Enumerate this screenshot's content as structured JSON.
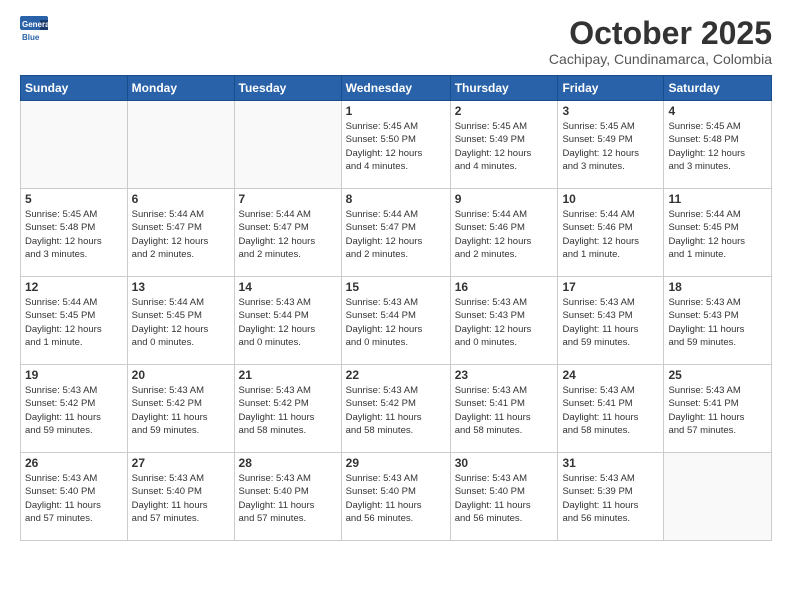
{
  "header": {
    "logo_general": "General",
    "logo_blue": "Blue",
    "month": "October 2025",
    "location": "Cachipay, Cundinamarca, Colombia"
  },
  "weekdays": [
    "Sunday",
    "Monday",
    "Tuesday",
    "Wednesday",
    "Thursday",
    "Friday",
    "Saturday"
  ],
  "weeks": [
    [
      {
        "day": "",
        "info": ""
      },
      {
        "day": "",
        "info": ""
      },
      {
        "day": "",
        "info": ""
      },
      {
        "day": "1",
        "info": "Sunrise: 5:45 AM\nSunset: 5:50 PM\nDaylight: 12 hours\nand 4 minutes."
      },
      {
        "day": "2",
        "info": "Sunrise: 5:45 AM\nSunset: 5:49 PM\nDaylight: 12 hours\nand 4 minutes."
      },
      {
        "day": "3",
        "info": "Sunrise: 5:45 AM\nSunset: 5:49 PM\nDaylight: 12 hours\nand 3 minutes."
      },
      {
        "day": "4",
        "info": "Sunrise: 5:45 AM\nSunset: 5:48 PM\nDaylight: 12 hours\nand 3 minutes."
      }
    ],
    [
      {
        "day": "5",
        "info": "Sunrise: 5:45 AM\nSunset: 5:48 PM\nDaylight: 12 hours\nand 3 minutes."
      },
      {
        "day": "6",
        "info": "Sunrise: 5:44 AM\nSunset: 5:47 PM\nDaylight: 12 hours\nand 2 minutes."
      },
      {
        "day": "7",
        "info": "Sunrise: 5:44 AM\nSunset: 5:47 PM\nDaylight: 12 hours\nand 2 minutes."
      },
      {
        "day": "8",
        "info": "Sunrise: 5:44 AM\nSunset: 5:47 PM\nDaylight: 12 hours\nand 2 minutes."
      },
      {
        "day": "9",
        "info": "Sunrise: 5:44 AM\nSunset: 5:46 PM\nDaylight: 12 hours\nand 2 minutes."
      },
      {
        "day": "10",
        "info": "Sunrise: 5:44 AM\nSunset: 5:46 PM\nDaylight: 12 hours\nand 1 minute."
      },
      {
        "day": "11",
        "info": "Sunrise: 5:44 AM\nSunset: 5:45 PM\nDaylight: 12 hours\nand 1 minute."
      }
    ],
    [
      {
        "day": "12",
        "info": "Sunrise: 5:44 AM\nSunset: 5:45 PM\nDaylight: 12 hours\nand 1 minute."
      },
      {
        "day": "13",
        "info": "Sunrise: 5:44 AM\nSunset: 5:45 PM\nDaylight: 12 hours\nand 0 minutes."
      },
      {
        "day": "14",
        "info": "Sunrise: 5:43 AM\nSunset: 5:44 PM\nDaylight: 12 hours\nand 0 minutes."
      },
      {
        "day": "15",
        "info": "Sunrise: 5:43 AM\nSunset: 5:44 PM\nDaylight: 12 hours\nand 0 minutes."
      },
      {
        "day": "16",
        "info": "Sunrise: 5:43 AM\nSunset: 5:43 PM\nDaylight: 12 hours\nand 0 minutes."
      },
      {
        "day": "17",
        "info": "Sunrise: 5:43 AM\nSunset: 5:43 PM\nDaylight: 11 hours\nand 59 minutes."
      },
      {
        "day": "18",
        "info": "Sunrise: 5:43 AM\nSunset: 5:43 PM\nDaylight: 11 hours\nand 59 minutes."
      }
    ],
    [
      {
        "day": "19",
        "info": "Sunrise: 5:43 AM\nSunset: 5:42 PM\nDaylight: 11 hours\nand 59 minutes."
      },
      {
        "day": "20",
        "info": "Sunrise: 5:43 AM\nSunset: 5:42 PM\nDaylight: 11 hours\nand 59 minutes."
      },
      {
        "day": "21",
        "info": "Sunrise: 5:43 AM\nSunset: 5:42 PM\nDaylight: 11 hours\nand 58 minutes."
      },
      {
        "day": "22",
        "info": "Sunrise: 5:43 AM\nSunset: 5:42 PM\nDaylight: 11 hours\nand 58 minutes."
      },
      {
        "day": "23",
        "info": "Sunrise: 5:43 AM\nSunset: 5:41 PM\nDaylight: 11 hours\nand 58 minutes."
      },
      {
        "day": "24",
        "info": "Sunrise: 5:43 AM\nSunset: 5:41 PM\nDaylight: 11 hours\nand 58 minutes."
      },
      {
        "day": "25",
        "info": "Sunrise: 5:43 AM\nSunset: 5:41 PM\nDaylight: 11 hours\nand 57 minutes."
      }
    ],
    [
      {
        "day": "26",
        "info": "Sunrise: 5:43 AM\nSunset: 5:40 PM\nDaylight: 11 hours\nand 57 minutes."
      },
      {
        "day": "27",
        "info": "Sunrise: 5:43 AM\nSunset: 5:40 PM\nDaylight: 11 hours\nand 57 minutes."
      },
      {
        "day": "28",
        "info": "Sunrise: 5:43 AM\nSunset: 5:40 PM\nDaylight: 11 hours\nand 57 minutes."
      },
      {
        "day": "29",
        "info": "Sunrise: 5:43 AM\nSunset: 5:40 PM\nDaylight: 11 hours\nand 56 minutes."
      },
      {
        "day": "30",
        "info": "Sunrise: 5:43 AM\nSunset: 5:40 PM\nDaylight: 11 hours\nand 56 minutes."
      },
      {
        "day": "31",
        "info": "Sunrise: 5:43 AM\nSunset: 5:39 PM\nDaylight: 11 hours\nand 56 minutes."
      },
      {
        "day": "",
        "info": ""
      }
    ]
  ]
}
